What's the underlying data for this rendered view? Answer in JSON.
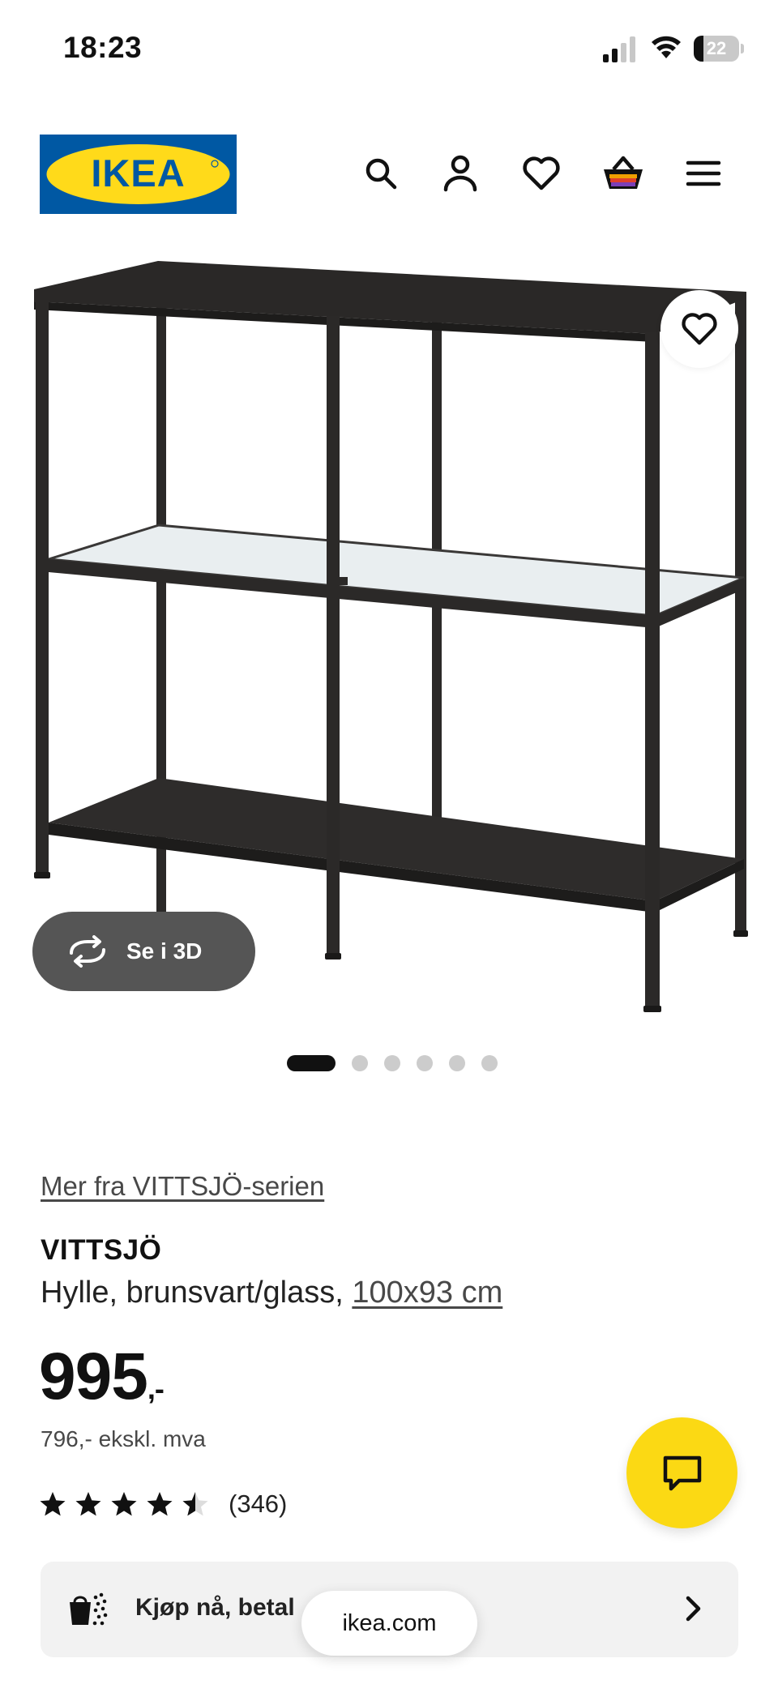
{
  "status_bar": {
    "time": "18:23",
    "battery_level": "22",
    "icons": [
      "signal-icon",
      "wifi-icon",
      "battery-icon"
    ]
  },
  "header": {
    "logo_text": "IKEA",
    "icons": [
      "search-icon",
      "user-icon",
      "heart-icon",
      "shopping-bag-icon",
      "menu-icon"
    ],
    "colors": {
      "logo_blue": "#0058a3",
      "logo_yellow": "#ffda1a"
    }
  },
  "product_image": {
    "favorite_icon": "heart-icon",
    "view_3d_label": "Se i 3D",
    "view_3d_icon": "rotate-3d-icon",
    "carousel": {
      "total": 6,
      "active_index": 0
    }
  },
  "product": {
    "series_link": "Mer fra VITTSJÖ-serien",
    "name": "VITTSJÖ",
    "description": "Hylle, brunsvart/glass, ",
    "size_link": "100x93 cm",
    "price": "995",
    "price_suffix": ",-",
    "price_ex_vat": "796,- ekskl. mva",
    "rating": {
      "value": 4.5,
      "max": 5,
      "review_count": "(346)"
    }
  },
  "chat_button": {
    "icon": "chat-icon",
    "color": "#fbd914"
  },
  "bnpl": {
    "icon": "wallet-icon",
    "text": "Kjøp nå, betal",
    "arrow_icon": "chevron-right-icon"
  },
  "browser": {
    "url": "ikea.com"
  }
}
